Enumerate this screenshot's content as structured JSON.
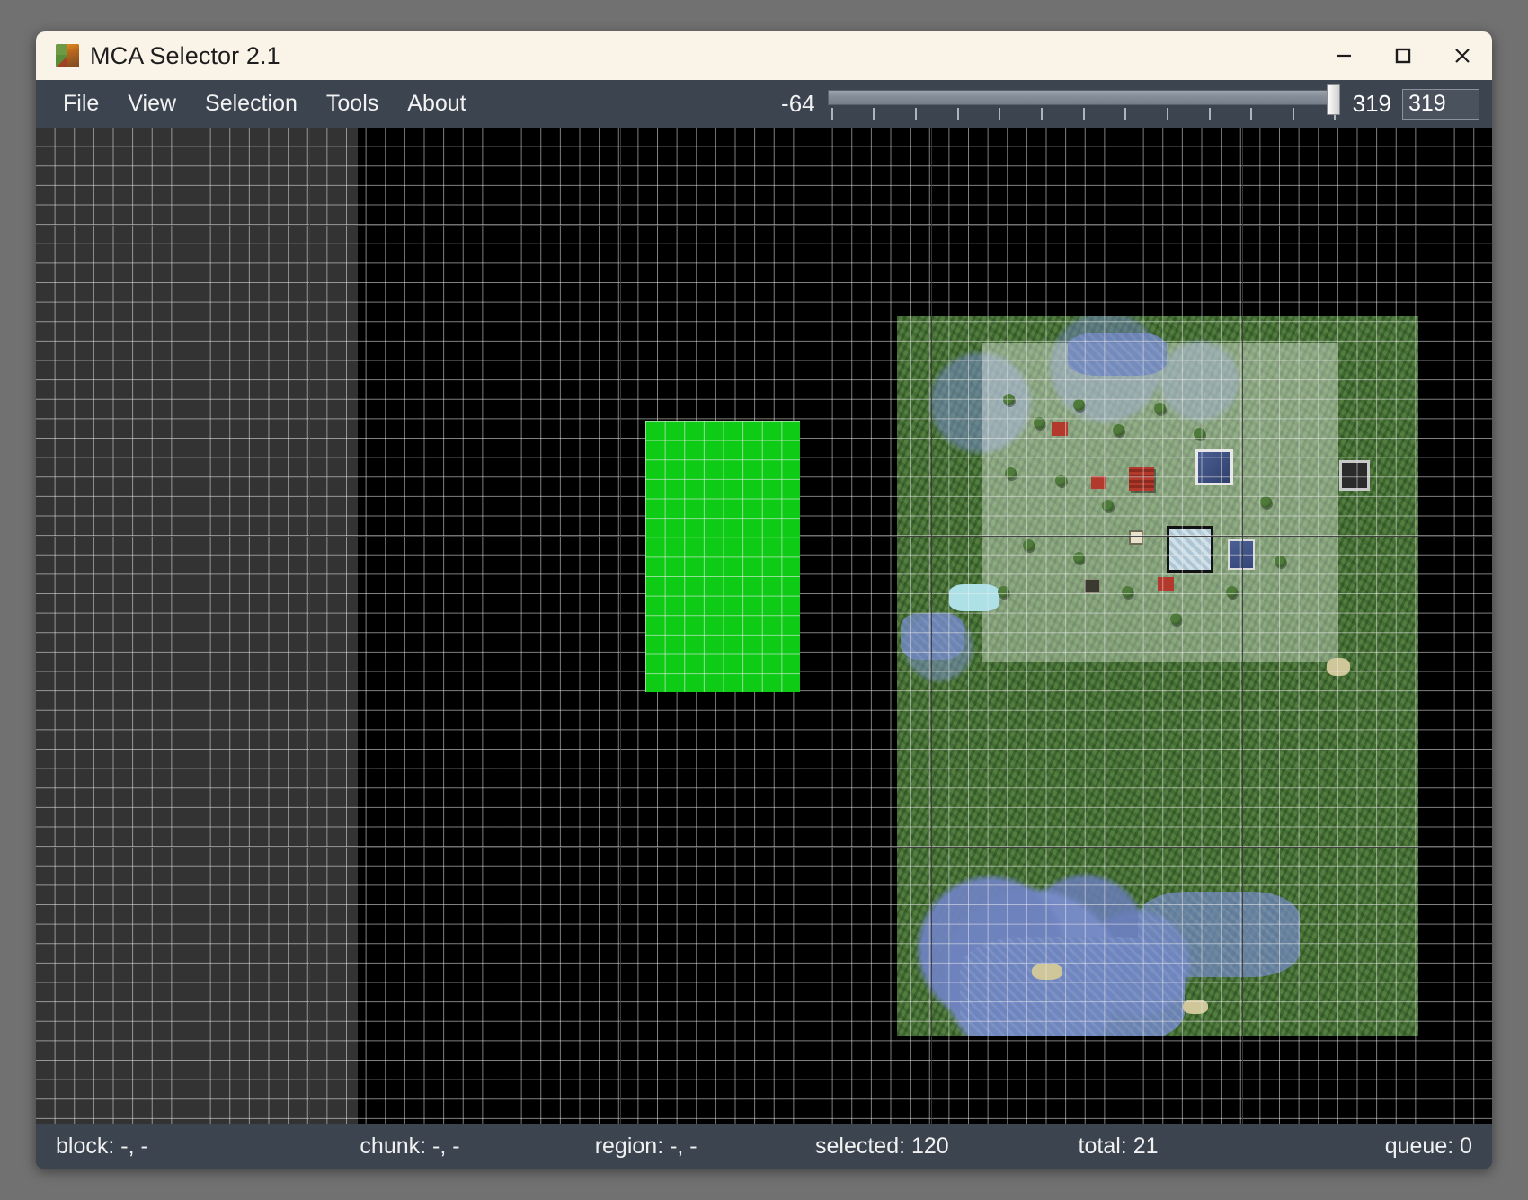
{
  "window": {
    "title": "MCA Selector 2.1",
    "icon": "minecraft-blocks-icon",
    "controls": {
      "minimize": "minimize-icon",
      "maximize": "maximize-icon",
      "close": "close-icon"
    }
  },
  "menu": {
    "items": [
      {
        "label": "File"
      },
      {
        "label": "View"
      },
      {
        "label": "Selection"
      },
      {
        "label": "Tools"
      },
      {
        "label": "About"
      }
    ]
  },
  "depth_slider": {
    "min_label": "-64",
    "max_label": "319",
    "value": "319",
    "min": -64,
    "max": 319,
    "tick_count": 13
  },
  "status": {
    "block": "block: -, -",
    "chunk": "chunk: -, -",
    "region": "region: -, -",
    "selected": "selected: 120",
    "total": "total: 21",
    "queue": "queue: 0"
  },
  "map": {
    "selection_color": "#0ecb16",
    "unloaded_panel_color": "#333333",
    "background_color": "#000000",
    "grid_color": "#ebebeb",
    "region_line_color": "#3c3c3c"
  },
  "colors": {
    "titlebar_bg": "#faf3e7",
    "chrome_bg": "#3c4450",
    "text": "#f1f1f1",
    "desktop": "#717171"
  }
}
